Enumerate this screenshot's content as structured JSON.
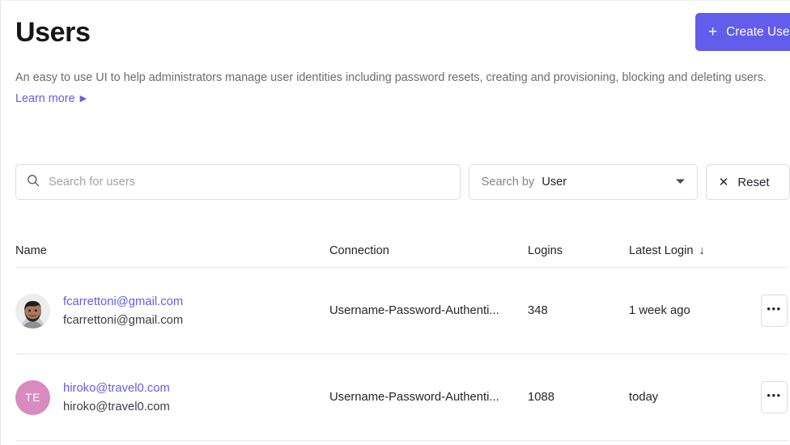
{
  "header": {
    "title": "Users",
    "description": "An easy to use UI to help administrators manage user identities including password resets, creating and provisioning, blocking and deleting users.",
    "learn_more": "Learn more",
    "learn_more_arrow": "▶",
    "create_user_label": "Create User",
    "create_user_plus": "+"
  },
  "colors": {
    "accent": "#635dec",
    "link": "#635dec",
    "avatar_pink": "#d98abe",
    "border": "#dcdce3",
    "text": "#24242c",
    "muted": "#6b6b76"
  },
  "filters": {
    "search_placeholder": "Search for users",
    "search_value": "",
    "search_icon": "search-icon",
    "search_by_label": "Search by",
    "search_by_value": "User",
    "search_by_options": [
      "User"
    ],
    "reset_label": "Reset",
    "reset_x": "✕"
  },
  "table": {
    "columns": [
      {
        "key": "name",
        "label": "Name",
        "sorted": false
      },
      {
        "key": "connection",
        "label": "Connection",
        "sorted": false
      },
      {
        "key": "logins",
        "label": "Logins",
        "sorted": false
      },
      {
        "key": "latest_login",
        "label": "Latest Login",
        "sorted": true,
        "sort_arrow": "↓"
      }
    ],
    "rows": [
      {
        "avatar_type": "photo",
        "avatar_initials": "",
        "name_primary": "fcarrettoni@gmail.com",
        "name_secondary": "fcarrettoni@gmail.com",
        "connection": "Username-Password-Authenti...",
        "logins": "348",
        "latest_login": "1 week ago",
        "action_label": "•••"
      },
      {
        "avatar_type": "initials",
        "avatar_initials": "TE",
        "name_primary": "hiroko@travel0.com",
        "name_secondary": "hiroko@travel0.com",
        "connection": "Username-Password-Authenti...",
        "logins": "1088",
        "latest_login": "today",
        "action_label": "•••"
      }
    ]
  }
}
